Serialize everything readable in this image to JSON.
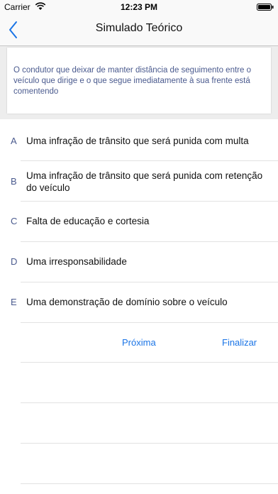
{
  "status": {
    "carrier": "Carrier",
    "time": "12:23 PM"
  },
  "nav": {
    "title": "Simulado Teórico"
  },
  "question": {
    "text": "O condutor que deixar de manter distância de seguimento entre o veículo que dirige e o que segue imediatamente à sua frente está comentendo"
  },
  "answers": [
    {
      "letter": "A",
      "text": "Uma infração de trânsito que será punida com multa"
    },
    {
      "letter": "B",
      "text": "Uma infração de trânsito que será punida com retenção do veículo"
    },
    {
      "letter": "C",
      "text": "Falta de educação e cortesia"
    },
    {
      "letter": "D",
      "text": "Uma irresponsabilidade"
    },
    {
      "letter": "E",
      "text": "Uma demonstração de domínio sobre o veículo"
    }
  ],
  "actions": {
    "next_label": "Próxima",
    "finish_label": "Finalizar"
  },
  "colors": {
    "accent": "#1a74e6",
    "question_text": "#4a5a8e",
    "background": "#ededed"
  },
  "icons": {
    "back": "chevron-left-icon",
    "wifi": "wifi-icon",
    "battery": "battery-icon"
  }
}
